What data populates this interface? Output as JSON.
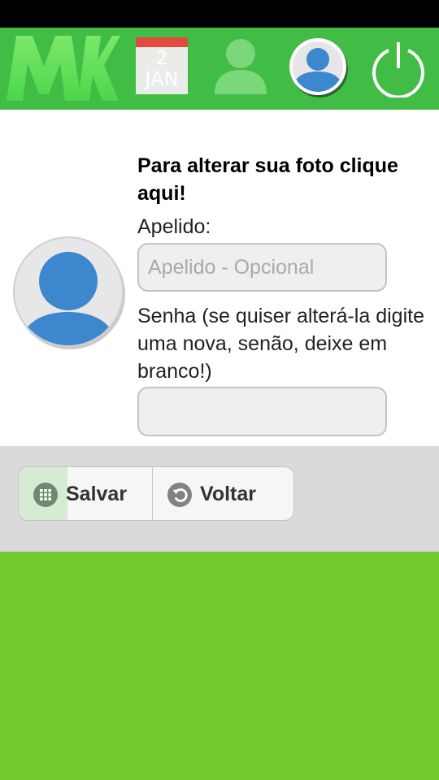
{
  "header": {
    "logo_text": "MK",
    "calendar": {
      "day": "2",
      "month": "JAN"
    },
    "icons": [
      "user-icon",
      "profile-photo-icon",
      "power-icon"
    ]
  },
  "form": {
    "heading": "Para alterar sua foto clique aqui!",
    "apelido_label": "Apelido:",
    "apelido_placeholder": "Apelido - Opcional",
    "apelido_value": "",
    "senha_label": "Senha (se quiser alterá-la digite uma nova, senão, deixe em branco!)",
    "senha_value": ""
  },
  "actions": {
    "save_label": "Salvar",
    "back_label": "Voltar"
  },
  "colors": {
    "header_green": "#41bd45",
    "page_green": "#72c92d",
    "avatar_blue": "#3d87ce"
  }
}
